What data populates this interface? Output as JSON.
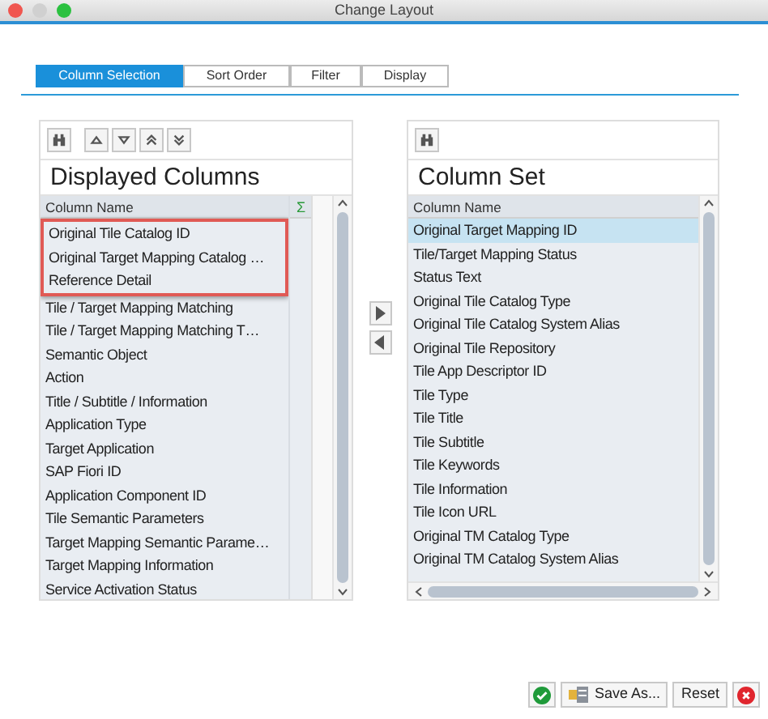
{
  "window": {
    "title": "Change Layout"
  },
  "tabs": [
    {
      "label": "Column Selection",
      "selected": true
    },
    {
      "label": "Sort Order",
      "selected": false
    },
    {
      "label": "Filter",
      "selected": false
    },
    {
      "label": "Display",
      "selected": false
    }
  ],
  "displayed": {
    "heading": "Displayed Columns",
    "column_header": "Column Name",
    "sum_header": "Σ",
    "rows": [
      {
        "label": "Original Tile Catalog ID",
        "highlighted": true
      },
      {
        "label": "Original Target Mapping Catalog …",
        "highlighted": true
      },
      {
        "label": "Reference Detail",
        "highlighted": true
      },
      {
        "label": "Tile / Target Mapping Matching",
        "highlighted": false
      },
      {
        "label": "Tile / Target Mapping Matching T…",
        "highlighted": false
      },
      {
        "label": "Semantic Object",
        "highlighted": false
      },
      {
        "label": "Action",
        "highlighted": false
      },
      {
        "label": "Title / Subtitle / Information",
        "highlighted": false
      },
      {
        "label": "Application Type",
        "highlighted": false
      },
      {
        "label": "Target Application",
        "highlighted": false
      },
      {
        "label": "SAP Fiori ID",
        "highlighted": false
      },
      {
        "label": "Application Component ID",
        "highlighted": false
      },
      {
        "label": "Tile Semantic Parameters",
        "highlighted": false
      },
      {
        "label": "Target Mapping Semantic Parame…",
        "highlighted": false
      },
      {
        "label": "Target Mapping Information",
        "highlighted": false
      },
      {
        "label": "Service Activation Status",
        "highlighted": false
      }
    ]
  },
  "column_set": {
    "heading": "Column Set",
    "column_header": "Column Name",
    "rows": [
      {
        "label": "Original Target Mapping ID",
        "selected": true
      },
      {
        "label": "Tile/Target Mapping Status",
        "selected": false
      },
      {
        "label": "Status Text",
        "selected": false
      },
      {
        "label": "Original Tile Catalog Type",
        "selected": false
      },
      {
        "label": "Original Tile Catalog System Alias",
        "selected": false
      },
      {
        "label": "Original Tile Repository",
        "selected": false
      },
      {
        "label": "Tile App Descriptor ID",
        "selected": false
      },
      {
        "label": "Tile Type",
        "selected": false
      },
      {
        "label": "Tile Title",
        "selected": false
      },
      {
        "label": "Tile Subtitle",
        "selected": false
      },
      {
        "label": "Tile Keywords",
        "selected": false
      },
      {
        "label": "Tile Information",
        "selected": false
      },
      {
        "label": "Tile Icon URL",
        "selected": false
      },
      {
        "label": "Original TM Catalog Type",
        "selected": false
      },
      {
        "label": "Original TM Catalog System Alias",
        "selected": false
      }
    ]
  },
  "buttons": [
    {
      "kind": "ok"
    },
    {
      "kind": "save",
      "label": "Save As..."
    },
    {
      "kind": "text",
      "label": "Reset"
    },
    {
      "kind": "cancel"
    }
  ]
}
